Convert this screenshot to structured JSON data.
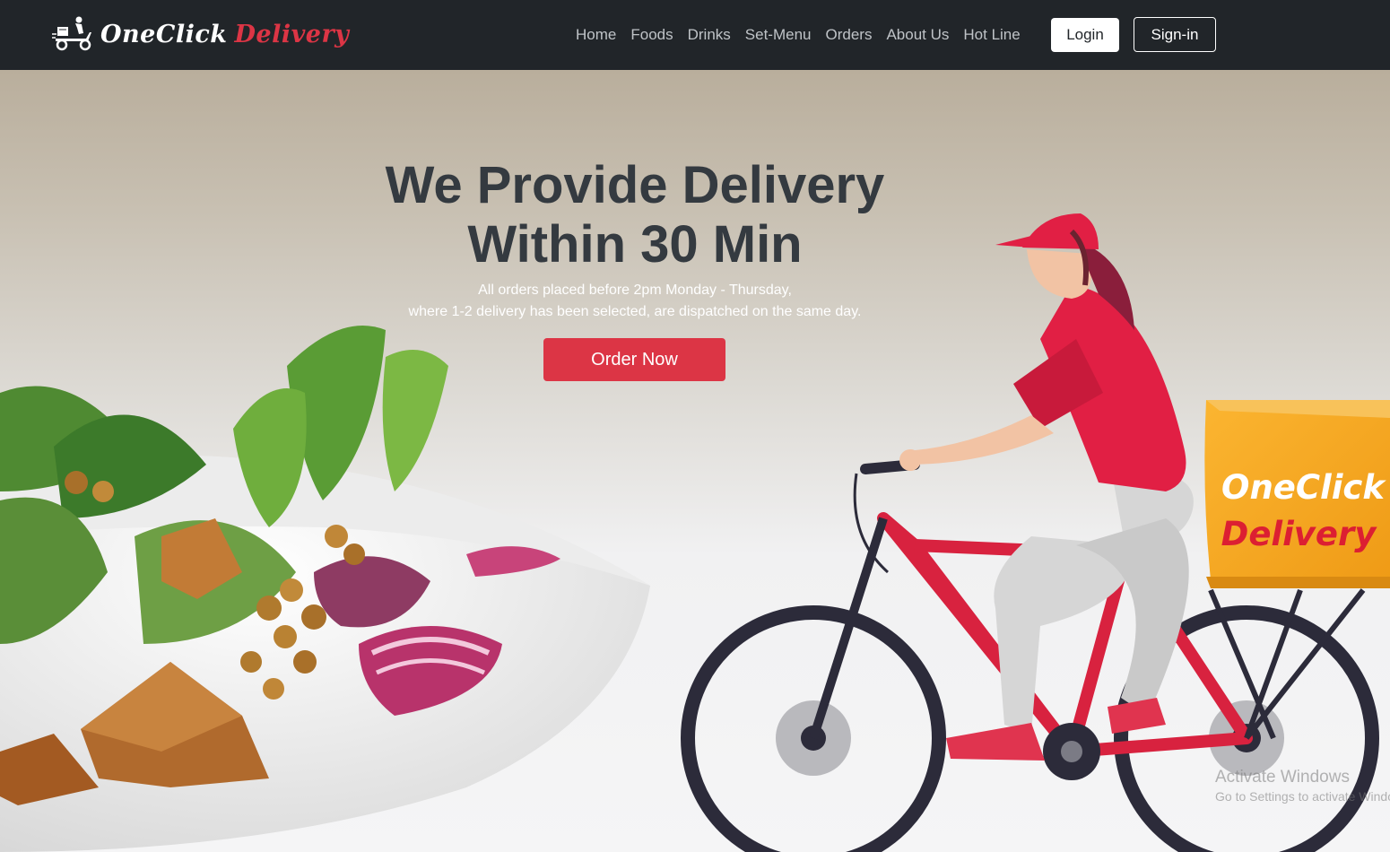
{
  "brand": {
    "name_part1": "OneClick",
    "name_part2": "Delivery",
    "icon": "delivery-scooter-icon"
  },
  "nav": {
    "links": [
      "Home",
      "Foods",
      "Drinks",
      "Set-Menu",
      "Orders",
      "About Us",
      "Hot Line"
    ],
    "login_label": "Login",
    "signin_label": "Sign-in"
  },
  "hero": {
    "title_line1": "We Provide Delivery",
    "title_line2": "Within 30 Min",
    "subtitle_line1": "All orders placed before 2pm Monday - Thursday,",
    "subtitle_line2": "where 1-2 delivery has been selected, are dispatched on the same day.",
    "cta_label": "Order Now",
    "box_text_line1": "OneClick",
    "box_text_line2": "Delivery"
  },
  "watermark": {
    "title": "Activate Windows",
    "subtitle": "Go to Settings to activate Windows."
  },
  "colors": {
    "navbar": "#212529",
    "accent": "#dc3545",
    "title": "#343a40",
    "box": "#f7a823"
  }
}
